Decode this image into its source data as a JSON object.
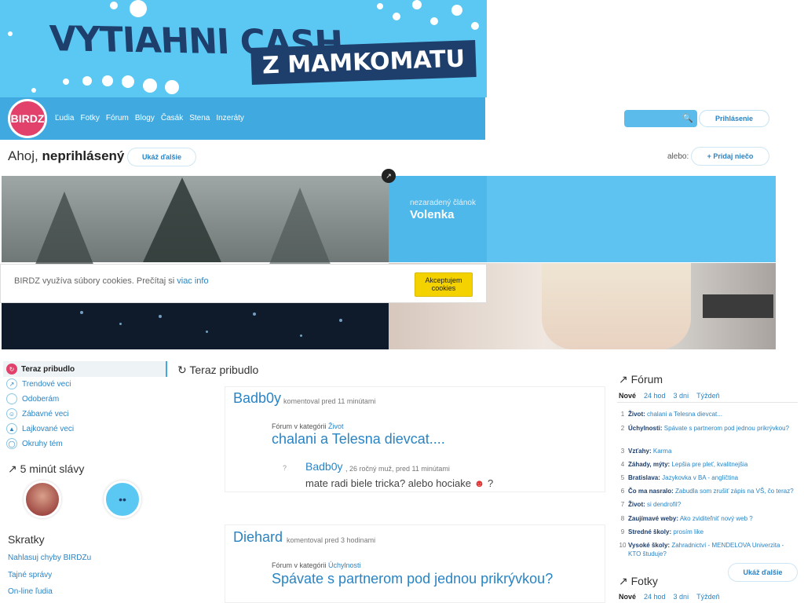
{
  "banner": {
    "line1": "VYTIAHNI CASH",
    "line2": "Z MAMKOMATU"
  },
  "brand": {
    "logo": "BIRDZ",
    "accent": "#3fa9e0",
    "logo_color": "#e1416a"
  },
  "nav": {
    "items": [
      "Ľudia",
      "Fotky",
      "Fórum",
      "Blogy",
      "Časák",
      "Stena",
      "Inzeráty"
    ]
  },
  "header": {
    "login": "Prihlásenie"
  },
  "greeting": {
    "hello": "Ahoj,",
    "user": "neprihlásený",
    "show_more": "Ukáž ďalšie",
    "or": "alebo:",
    "add": "+ Pridaj niečo"
  },
  "hero": {
    "category": "nezaradený článok",
    "title": "Volenka"
  },
  "cookie": {
    "text": "BIRDZ využíva súbory cookies. Prečítaj si",
    "link": "viac info",
    "button": "Akceptujem cookies"
  },
  "sidebar": {
    "active": "Teraz pribudlo",
    "items": [
      "Trendové veci",
      "Odoberám",
      "Zábavné veci",
      "Lajkované veci",
      "Okruhy tém"
    ],
    "fame_title": "5 minút slávy",
    "shortcuts_title": "Skratky",
    "shortcuts": [
      "Nahlasuj chyby BIRDZu",
      "Tajné správy",
      "On-line ľudia"
    ]
  },
  "feed": {
    "title": "Teraz pribudlo",
    "posts": [
      {
        "author": "Badb0y",
        "meta": "komentoval pred 11 minútami",
        "in_label": "Fórum v kategórii",
        "category": "Život",
        "title": "chalani a Telesna dievcat....",
        "c_author": "Badb0y",
        "c_meta": ", 26 ročný muž, pred 11 minútami",
        "c_text": "mate radi biele tricka? alebo hociake",
        "c_end": "?"
      },
      {
        "author": "Diehard",
        "meta": "komentoval pred 3 hodinami",
        "in_label": "Fórum v kategórii",
        "category": "Úchylnosti",
        "title": "Spávate s partnerom pod jednou prikrývkou?"
      }
    ]
  },
  "forum": {
    "title": "Fórum",
    "tabs": [
      "Nové",
      "24 hod",
      "3 dni",
      "Týždeň"
    ],
    "items": [
      {
        "n": "1",
        "cat": "Život:",
        "text": "chalani a Telesna dievcat..."
      },
      {
        "n": "2",
        "cat": "Úchylnosti:",
        "text": "Spávate s partnerom pod jednou prikrývkou?"
      },
      {
        "n": "3",
        "cat": "Vzťahy:",
        "text": "Karma"
      },
      {
        "n": "4",
        "cat": "Záhady, mýty:",
        "text": "Lepšia pre pleť, kvalitnejšia"
      },
      {
        "n": "5",
        "cat": "Bratislava:",
        "text": "Jazykovka v BA - angličtina"
      },
      {
        "n": "6",
        "cat": "Čo ma nasralo:",
        "text": "Zabudla som zrušiť zápis na VŠ, čo teraz?"
      },
      {
        "n": "7",
        "cat": "Život:",
        "text": "si dendrofil?"
      },
      {
        "n": "8",
        "cat": "Zaujímavé weby:",
        "text": "Ako zviditeľniť nový web ?"
      },
      {
        "n": "9",
        "cat": "Stredné školy:",
        "text": "prosím like"
      },
      {
        "n": "10",
        "cat": "Vysoké školy:",
        "text": "Zahradnictví - MENDELOVA Univerzita - KTO študuje?"
      }
    ],
    "more": "Ukáž ďalšie"
  },
  "photos": {
    "title": "Fotky",
    "tabs": [
      "Nové",
      "24 hod",
      "3 dni",
      "Týždeň"
    ]
  }
}
